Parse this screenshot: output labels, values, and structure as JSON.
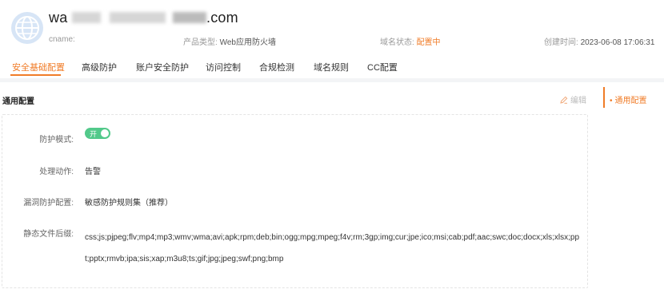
{
  "header": {
    "domain_prefix": "wa",
    "domain_suffix": ".com",
    "cname_label": "cname:",
    "product_type_label": "产品类型:",
    "product_type_value": "Web应用防火墙",
    "domain_status_label": "域名状态:",
    "domain_status_value": "配置中",
    "created_label": "创建时间:",
    "created_value": "2023-06-08 17:06:31"
  },
  "tabs": [
    {
      "label": "安全基础配置",
      "active": true
    },
    {
      "label": "高级防护"
    },
    {
      "label": "账户安全防护"
    },
    {
      "label": "访问控制"
    },
    {
      "label": "合规检测"
    },
    {
      "label": "域名规则"
    },
    {
      "label": "CC配置"
    }
  ],
  "section": {
    "title": "通用配置",
    "edit_label": "编辑",
    "side_link_label": "通用配置"
  },
  "form": {
    "protection_mode_label": "防护模式:",
    "protection_mode_toggle": "开",
    "action_label": "处理动作:",
    "action_value": "告警",
    "vuln_label": "漏洞防护配置:",
    "vuln_value": "敏感防护规则集（推荐）",
    "static_label": "静态文件后缀:",
    "static_value": "css;js;pjpeg;flv;mp4;mp3;wmv;wma;avi;apk;rpm;deb;bin;ogg;mpg;mpeg;f4v;rm;3gp;img;cur;jpe;ico;msi;cab;pdf;aac;swc;doc;docx;xls;xlsx;ppt;pptx;rmvb;ipa;sis;xap;m3u8;ts;gif;jpg;jpeg;swf;png;bmp"
  },
  "colors": {
    "accent": "#f07c28",
    "toggle_on": "#52c98a",
    "globe": "#a9c7ea"
  },
  "icons": {
    "globe": "globe-icon",
    "edit": "pencil-icon"
  }
}
